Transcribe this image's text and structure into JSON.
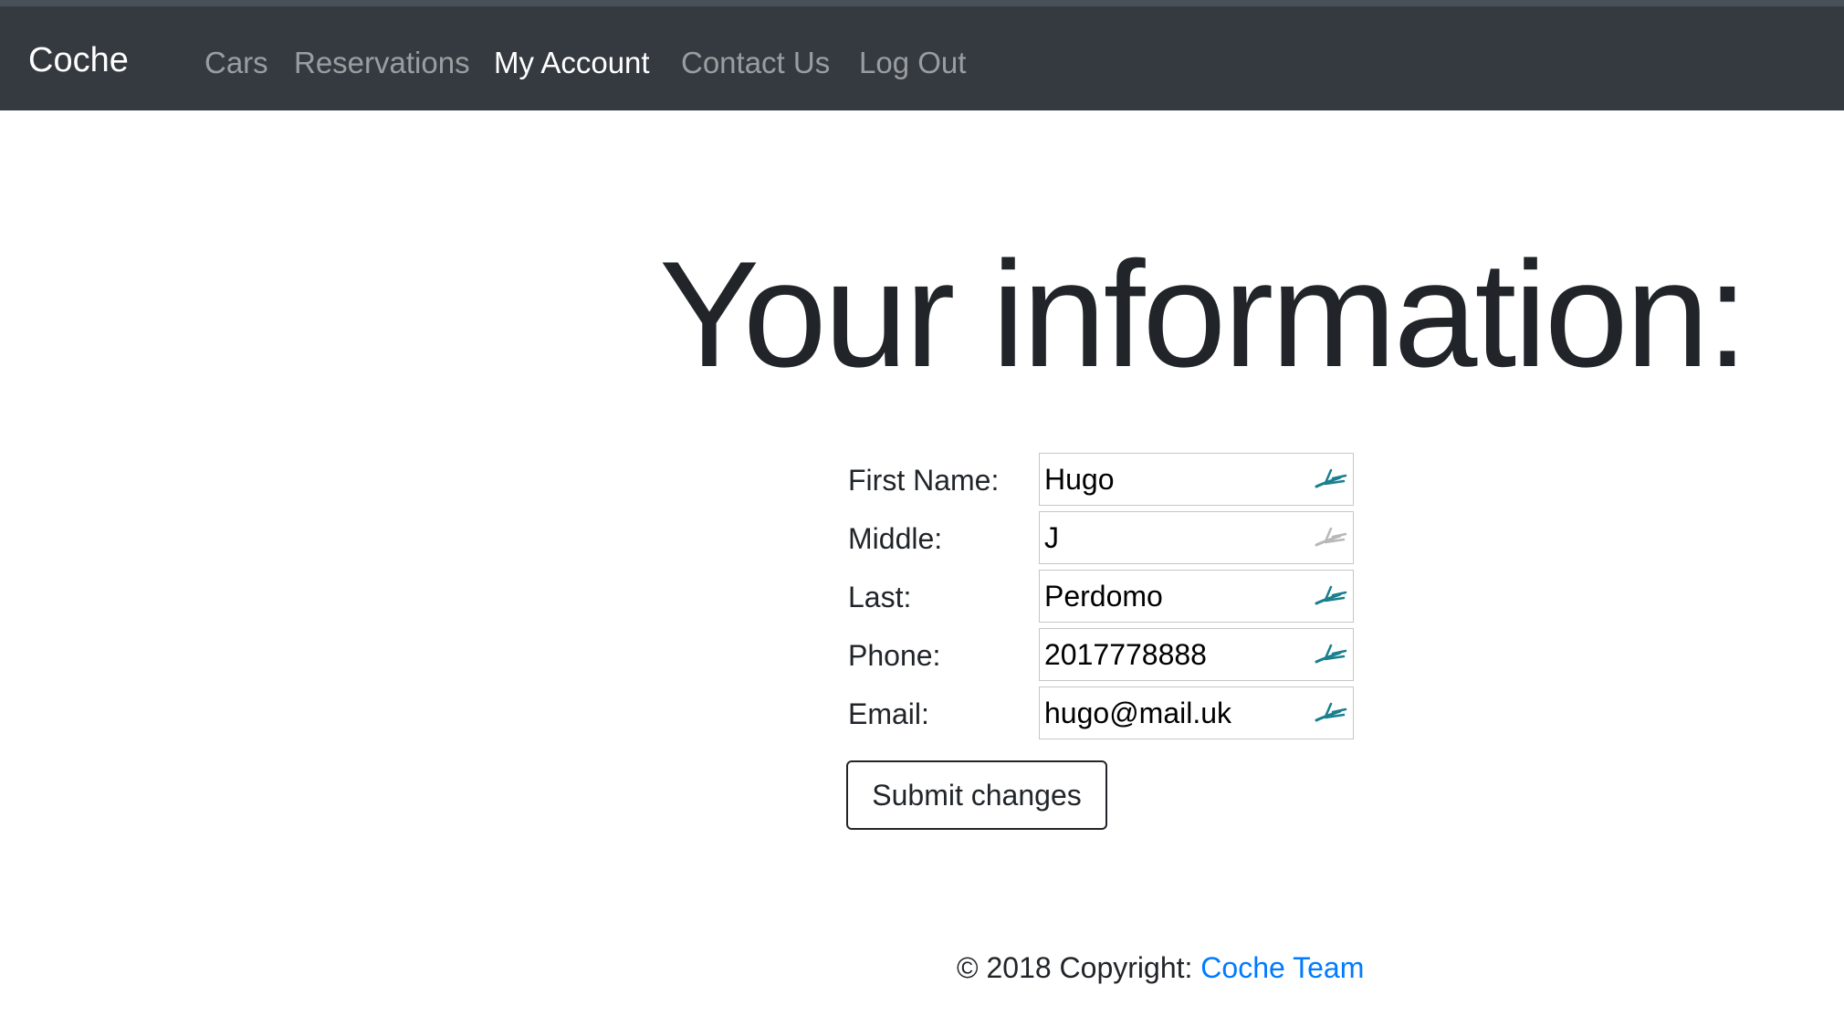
{
  "navbar": {
    "brand": "Coche",
    "links": [
      {
        "label": "Cars",
        "active": false
      },
      {
        "label": "Reservations",
        "active": false
      },
      {
        "label": "My Account",
        "active": true
      },
      {
        "label": "Contact Us",
        "active": false
      },
      {
        "label": "Log Out",
        "active": false
      }
    ]
  },
  "main": {
    "heading": "Your information:",
    "fields": [
      {
        "label": "First Name:",
        "value": "Hugo",
        "icon": "password-manager-icon",
        "icon_color": "#1a7f8e"
      },
      {
        "label": "Middle:",
        "value": "J",
        "icon": "password-manager-icon",
        "icon_color": "#b8b8b8"
      },
      {
        "label": "Last:",
        "value": "Perdomo",
        "icon": "password-manager-icon",
        "icon_color": "#1a7f8e"
      },
      {
        "label": "Phone:",
        "value": "2017778888",
        "icon": "password-manager-icon",
        "icon_color": "#1a7f8e"
      },
      {
        "label": "Email:",
        "value": "hugo@mail.uk",
        "icon": "password-manager-icon",
        "icon_color": "#1a7f8e"
      }
    ],
    "submit_label": "Submit changes"
  },
  "footer": {
    "copyright": "© 2018 Copyright: ",
    "link_text": "Coche Team"
  },
  "colors": {
    "navbar_bg": "#343a40",
    "link": "#007bff",
    "icon_active": "#1a7f8e",
    "icon_inactive": "#b8b8b8"
  }
}
